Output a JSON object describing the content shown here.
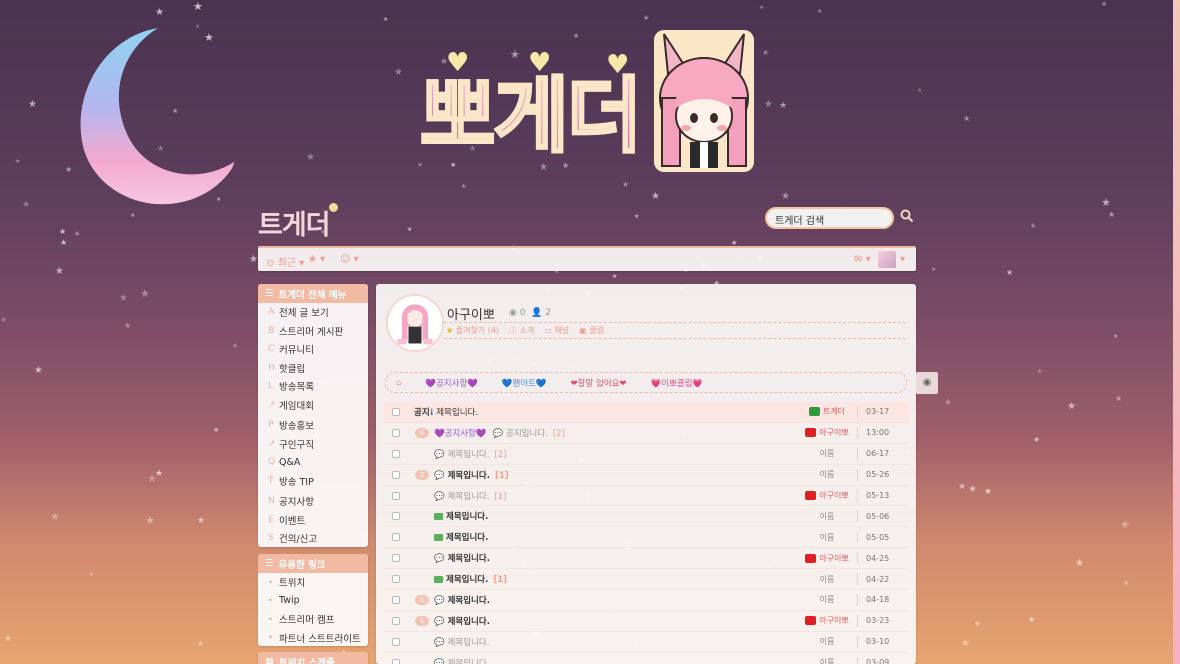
{
  "site": {
    "logo_big": "뽀게더",
    "logo_small": "트게더"
  },
  "search": {
    "placeholder": "트게더 검색"
  },
  "navbar": {
    "recent": "최근",
    "favorites": "★",
    "emoji": "☺",
    "mail": "✉"
  },
  "sidebar": {
    "menu_title": "트게더 전체 메뉴",
    "groups": [
      [
        {
          "key": "A",
          "label": "전체 글 보기"
        },
        {
          "key": "B",
          "label": "스트리머 게시판"
        },
        {
          "key": "C",
          "label": "커뮤니티"
        },
        {
          "key": "H",
          "label": "핫클립"
        },
        {
          "key": "L",
          "label": "방송목록"
        },
        {
          "key": "↗",
          "label": "게임대회"
        }
      ],
      [
        {
          "key": "P",
          "label": "방송홍보"
        },
        {
          "key": "↗",
          "label": "구인구직"
        },
        {
          "key": "Q",
          "label": "Q&A"
        },
        {
          "key": "T",
          "label": "방송 TIP"
        }
      ],
      [
        {
          "key": "N",
          "label": "공지사항"
        },
        {
          "key": "E",
          "label": "이벤트"
        },
        {
          "key": "S",
          "label": "건의/신고"
        }
      ]
    ],
    "links_title": "유용한 링크",
    "links": [
      {
        "label": "트위치"
      },
      {
        "label": "Twip"
      },
      {
        "label": "스트리머 캠프"
      },
      {
        "label": "파트너 스트트라이트"
      }
    ],
    "third_title": "트위치 스케줄"
  },
  "profile": {
    "name": "아구이뽀",
    "stat_views": "0",
    "stat_members": "2",
    "links": {
      "favorite": "즐겨찾기 (4)",
      "intro": "소개",
      "channel": "채널",
      "clip": "클립"
    }
  },
  "categories": [
    "💜공지사항💜",
    "💙팬아트💙",
    "❤할말 있어요❤",
    "💗이뽀클립💗"
  ],
  "posts": [
    {
      "lbl": "공지",
      "title": "제목입니다.",
      "author": "트게더",
      "date": "03-17",
      "notice": true
    },
    {
      "num": "4",
      "tag": "💜공지사항💜",
      "title": "공지입니다.",
      "cc": "[2]",
      "author": "아구이뽀",
      "date": "13:00",
      "faded": true
    },
    {
      "title": "제목입니다.",
      "cc": "[2]",
      "author": "이름",
      "date": "06-17",
      "faded": true
    },
    {
      "num": "2",
      "title": "제목입니다.",
      "cc": "[1]",
      "author": "이름",
      "date": "05-26",
      "bold": true
    },
    {
      "title": "제목입니다.",
      "cc": "[1]",
      "author": "아구이뽀",
      "date": "05-13",
      "faded": true
    },
    {
      "title": "제목입니다.",
      "author": "이름",
      "date": "05-06",
      "bold": true,
      "pic": true
    },
    {
      "title": "제목입니다.",
      "author": "이름",
      "date": "05-05",
      "bold": true,
      "pic": true
    },
    {
      "title": "제목입니다.",
      "author": "아구이뽀",
      "date": "04-25",
      "bold": true
    },
    {
      "title": "제목입니다.",
      "cc": "[1]",
      "author": "이름",
      "date": "04-22",
      "bold": true,
      "pic": true
    },
    {
      "num": "1",
      "title": "제목입니다.",
      "author": "이름",
      "date": "04-18",
      "bold": true
    },
    {
      "num": "1",
      "title": "제목입니다.",
      "author": "아구이뽀",
      "date": "03-23",
      "bold": true
    },
    {
      "title": "제목입니다.",
      "author": "이름",
      "date": "03-10",
      "faded": true
    },
    {
      "title": "제목입니다.",
      "author": "이름",
      "date": "03-09",
      "faded": true
    }
  ],
  "colors": {
    "accent": "#f2b9a3",
    "title_pink": "#d97fa4",
    "link_orange": "#f29a86"
  }
}
